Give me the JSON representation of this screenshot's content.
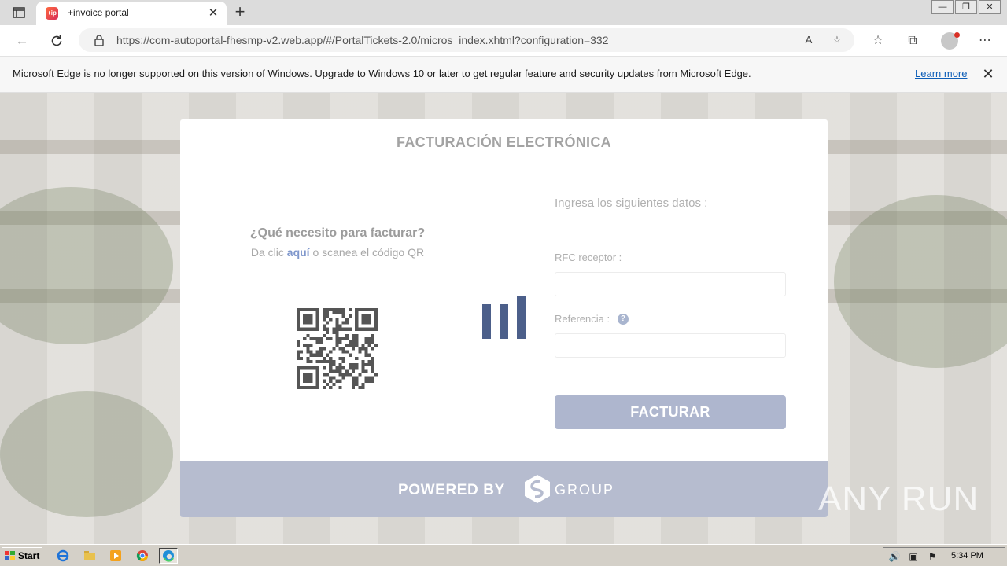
{
  "browser": {
    "tab_title": "+invoice portal",
    "tab_favicon_text": "+ip",
    "new_tab_label": "+",
    "close_tab_label": "✕",
    "url": "https://com-autoportal-fhesmp-v2.web.app/#/PortalTickets-2.0/micros_index.xhtml?configuration=332",
    "read_aloud_label": "A",
    "window_minimize": "—",
    "window_restore": "❐",
    "window_close": "✕"
  },
  "infobar": {
    "message": "Microsoft Edge is no longer supported on this version of Windows. Upgrade to Windows 10 or later to get regular feature and security updates from Microsoft Edge.",
    "learn_more": "Learn more",
    "close_label": "✕"
  },
  "card": {
    "title": "FACTURACIÓN ELECTRÓNICA",
    "help_title": "¿Qué necesito para facturar?",
    "help_prefix": "Da clic ",
    "help_link": "aquí",
    "help_suffix": " o scanea el código QR",
    "form_heading": "Ingresa los siguientes datos :",
    "rfc_label": "RFC receptor :",
    "rfc_value": "",
    "referencia_label": "Referencia :",
    "referencia_value": "",
    "help_icon_label": "?",
    "submit_label": "FACTURAR",
    "footer_powered": "POWERED BY",
    "footer_brand": "GROUP"
  },
  "watermark": "ANY RUN",
  "taskbar": {
    "start_label": "Start",
    "clock": "5:34 PM"
  },
  "colors": {
    "accent_blue": "#4c5f8a",
    "button_bg": "#aeb6ce",
    "footer_bg": "#b6bccf",
    "link": "#0f5fb8"
  }
}
